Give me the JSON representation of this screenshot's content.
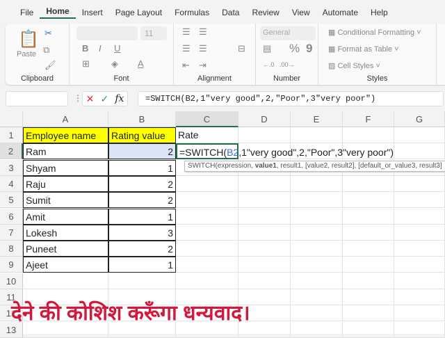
{
  "menu": [
    "File",
    "Home",
    "Insert",
    "Page Layout",
    "Formulas",
    "Data",
    "Review",
    "View",
    "Automate",
    "Help"
  ],
  "ribbon": {
    "paste": "Paste",
    "clipboard": "Clipboard",
    "font_size": "11",
    "font": "Font",
    "alignment": "Alignment",
    "number_format": "General",
    "number": "Number",
    "cond_format": "Conditional Formatting",
    "format_table": "Format as Table",
    "cell_styles": "Cell Styles",
    "styles": "Styles",
    "bold": "B",
    "italic": "I",
    "underline": "U",
    "percent": "%",
    "comma": "9"
  },
  "formula_bar": {
    "name_box": "",
    "fx": "fx",
    "formula": "=SWITCH(B2,1\"very good\",2,\"Poor\",3\"very poor\")"
  },
  "columns": [
    "A",
    "B",
    "C",
    "D",
    "E",
    "F",
    "G"
  ],
  "rows": [
    "1",
    "2",
    "3",
    "4",
    "5",
    "6",
    "7",
    "8",
    "9",
    "10",
    "11",
    "12",
    "13"
  ],
  "headers": {
    "a": "Employee name",
    "b": "Rating value",
    "c": "Rate"
  },
  "data": [
    {
      "name": "Ram",
      "rating": "2"
    },
    {
      "name": "Shyam",
      "rating": "1"
    },
    {
      "name": "Raju",
      "rating": "2"
    },
    {
      "name": "Sumit",
      "rating": "2"
    },
    {
      "name": "Amit",
      "rating": "1"
    },
    {
      "name": "Lokesh",
      "rating": "3"
    },
    {
      "name": "Puneet",
      "rating": "2"
    },
    {
      "name": "Ajeet",
      "rating": "1"
    }
  ],
  "edit_cell": {
    "prefix": "=SWITCH(",
    "ref": "B2",
    "suffix": ",1\"very good\",2,\"Poor\",3\"very poor\")"
  },
  "tooltip": {
    "pre": "SWITCH(expression, ",
    "bold": "value1",
    "post": ", result1, [value2, result2], [default_or_value3, result3]"
  },
  "caption": "देने की कोशिश करूँगा धन्यवाद।",
  "colors": {
    "header_fill": "#ffff00",
    "accent": "#1e7145",
    "caption": "#d6173c"
  }
}
